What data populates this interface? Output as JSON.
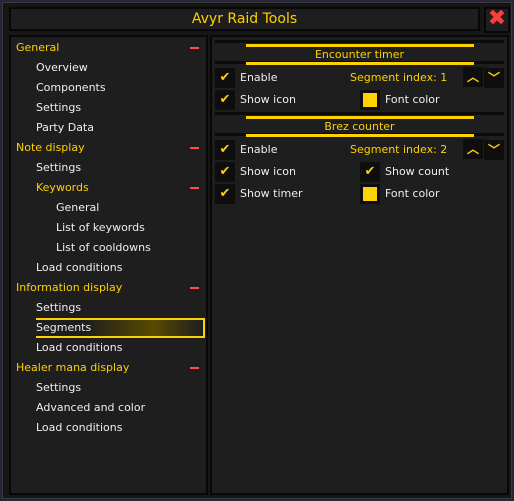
{
  "window": {
    "title": "Avyr Raid Tools",
    "close_icon": "close-x-icon",
    "accent": "#ffd100"
  },
  "tree": [
    {
      "label": "General",
      "level": 0,
      "collapsible": true
    },
    {
      "label": "Overview",
      "level": 1
    },
    {
      "label": "Components",
      "level": 1
    },
    {
      "label": "Settings",
      "level": 1
    },
    {
      "label": "Party Data",
      "level": 1
    },
    {
      "label": "Note display",
      "level": 0,
      "collapsible": true
    },
    {
      "label": "Settings",
      "level": 1
    },
    {
      "label": "Keywords",
      "level": 1,
      "category": true,
      "collapsible": true
    },
    {
      "label": "General",
      "level": 2
    },
    {
      "label": "List of keywords",
      "level": 2
    },
    {
      "label": "List of cooldowns",
      "level": 2
    },
    {
      "label": "Load conditions",
      "level": 1
    },
    {
      "label": "Information display",
      "level": 0,
      "collapsible": true
    },
    {
      "label": "Settings",
      "level": 1
    },
    {
      "label": "Segments",
      "level": 1,
      "selected": true
    },
    {
      "label": "Load conditions",
      "level": 1
    },
    {
      "label": "Healer mana display",
      "level": 0,
      "collapsible": true
    },
    {
      "label": "Settings",
      "level": 1
    },
    {
      "label": "Advanced and color",
      "level": 1
    },
    {
      "label": "Load conditions",
      "level": 1
    }
  ],
  "sections": [
    {
      "title": "Encounter timer",
      "segment_index": "Segment index: 1",
      "options": [
        {
          "label": "Enable",
          "type": "checkbox",
          "checked": true
        },
        {
          "label": "Show icon",
          "type": "checkbox",
          "checked": true
        },
        {
          "label": "Font color",
          "type": "color",
          "color": "#ffd100"
        }
      ]
    },
    {
      "title": "Brez counter",
      "segment_index": "Segment index: 2",
      "options": [
        {
          "label": "Enable",
          "type": "checkbox",
          "checked": true
        },
        {
          "label": "Show icon",
          "type": "checkbox",
          "checked": true
        },
        {
          "label": "Show count",
          "type": "checkbox",
          "checked": true
        },
        {
          "label": "Show timer",
          "type": "checkbox",
          "checked": true
        },
        {
          "label": "Font color",
          "type": "color",
          "color": "#ffd100"
        }
      ]
    }
  ]
}
